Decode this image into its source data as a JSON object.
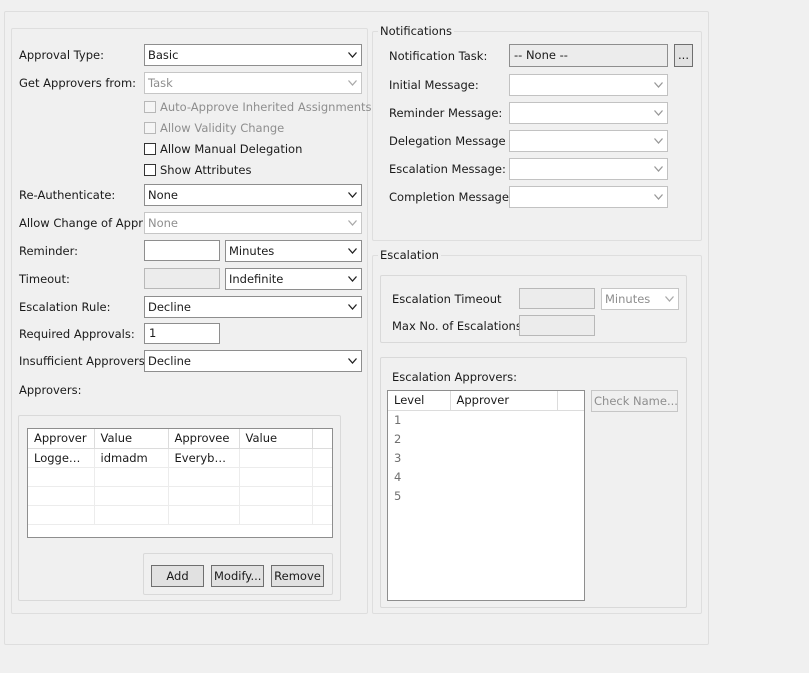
{
  "left": {
    "approval_type": {
      "label": "Approval Type:",
      "value": "Basic"
    },
    "get_approvers_from": {
      "label": "Get Approvers from:",
      "value": "Task"
    },
    "checks": [
      {
        "label": "Auto-Approve Inherited Assignments",
        "enabled": false,
        "checked": false
      },
      {
        "label": "Allow Validity Change",
        "enabled": false,
        "checked": false
      },
      {
        "label": "Allow Manual Delegation",
        "enabled": true,
        "checked": false
      },
      {
        "label": "Show Attributes",
        "enabled": true,
        "checked": false
      }
    ],
    "re_authenticate": {
      "label": "Re-Authenticate:",
      "value": "None"
    },
    "allow_change": {
      "label": "Allow Change of Appr:",
      "value": "None"
    },
    "reminder": {
      "label": "Reminder:",
      "value": "",
      "unit": "Minutes"
    },
    "timeout": {
      "label": "Timeout:",
      "value": "",
      "unit": "Indefinite"
    },
    "escalation_rule": {
      "label": "Escalation Rule:",
      "value": "Decline"
    },
    "required_approvals": {
      "label": "Required Approvals:",
      "value": "1"
    },
    "insufficient_approvers": {
      "label": "Insufficient Approvers:",
      "value": "Decline"
    },
    "approvers_label": "Approvers:",
    "approvers_table": {
      "columns": [
        "Approver",
        "Value",
        "Approvee",
        "Value"
      ],
      "rows": [
        [
          "Logged-...",
          "idmadm",
          "Everybody",
          ""
        ]
      ]
    },
    "buttons": {
      "add": "Add",
      "modify": "Modify...",
      "remove": "Remove"
    }
  },
  "notifications": {
    "title": "Notifications",
    "task": {
      "label": "Notification Task:",
      "value": "-- None --",
      "browse": "..."
    },
    "messages": [
      {
        "label": "Initial Message:",
        "value": ""
      },
      {
        "label": "Reminder Message:",
        "value": ""
      },
      {
        "label": "Delegation Message",
        "value": ""
      },
      {
        "label": "Escalation Message:",
        "value": ""
      },
      {
        "label": "Completion Message:",
        "value": ""
      }
    ]
  },
  "escalation": {
    "title": "Escalation",
    "timeout": {
      "label": "Escalation Timeout",
      "value": "",
      "unit": "Minutes"
    },
    "max": {
      "label": "Max No. of Escalations:",
      "value": ""
    },
    "approvers_label": "Escalation Approvers:",
    "table": {
      "columns": [
        "Level",
        "Approver"
      ],
      "levels": [
        "1",
        "2",
        "3",
        "4",
        "5"
      ]
    },
    "check_name": "Check Name..."
  },
  "icons": {
    "dropdown": "chevron-down-icon"
  }
}
